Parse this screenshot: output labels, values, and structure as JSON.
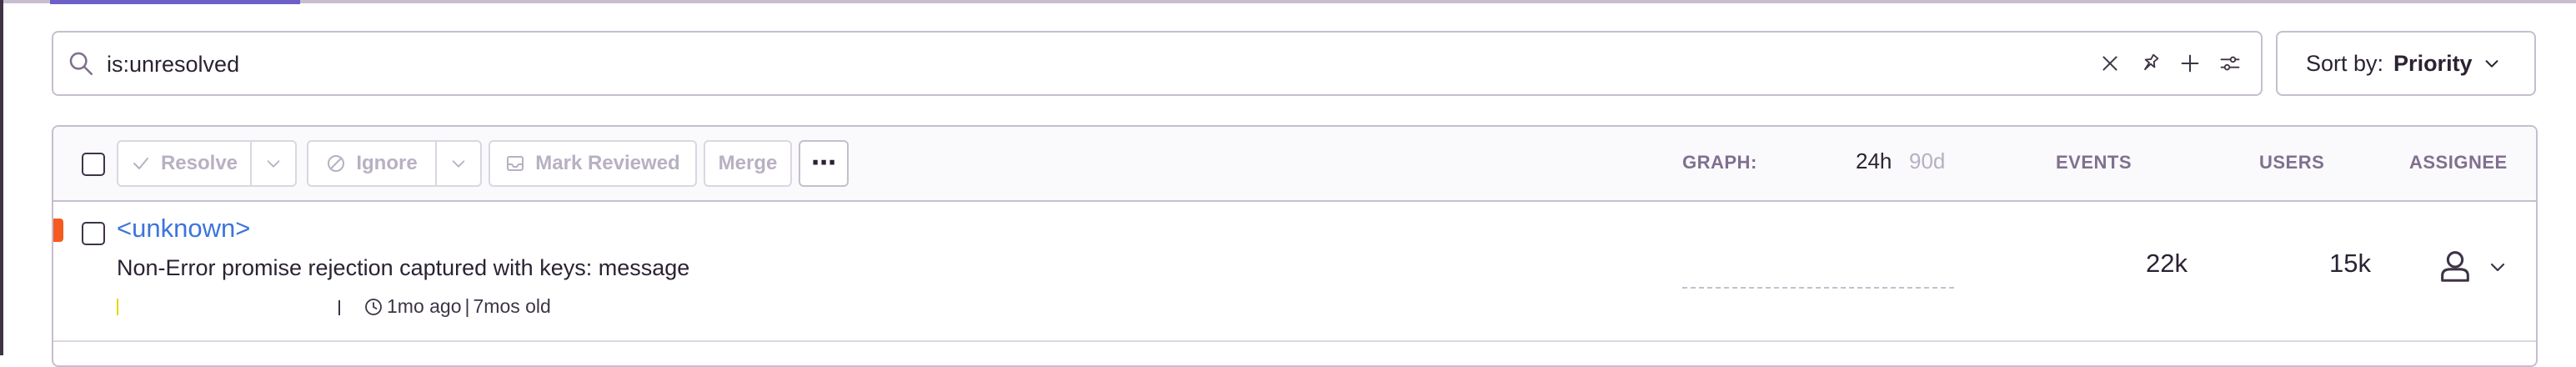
{
  "search": {
    "query": "is:unresolved",
    "icons": [
      "search-icon",
      "clear-icon",
      "pin-icon",
      "add-icon",
      "settings-icon"
    ]
  },
  "sort": {
    "label": "Sort by:",
    "value": "Priority"
  },
  "toolbar": {
    "resolve_label": "Resolve",
    "ignore_label": "Ignore",
    "mark_reviewed_label": "Mark Reviewed",
    "merge_label": "Merge",
    "more_label": "⋯"
  },
  "columns": {
    "graph_label": "GRAPH:",
    "graph_options": [
      "24h",
      "90d"
    ],
    "graph_selected": "24h",
    "events": "EVENTS",
    "users": "USERS",
    "assignee": "ASSIGNEE"
  },
  "issues": [
    {
      "title": "<unknown>",
      "message": "Non-Error promise rejection captured with keys: message",
      "last_seen": "1mo ago",
      "age": "7mos old",
      "events": "22k",
      "users": "15k",
      "level_color": "#f55a1e"
    }
  ],
  "colors": {
    "accent": "#6c5fc7",
    "link": "#3d74db",
    "border": "#c6becf"
  }
}
